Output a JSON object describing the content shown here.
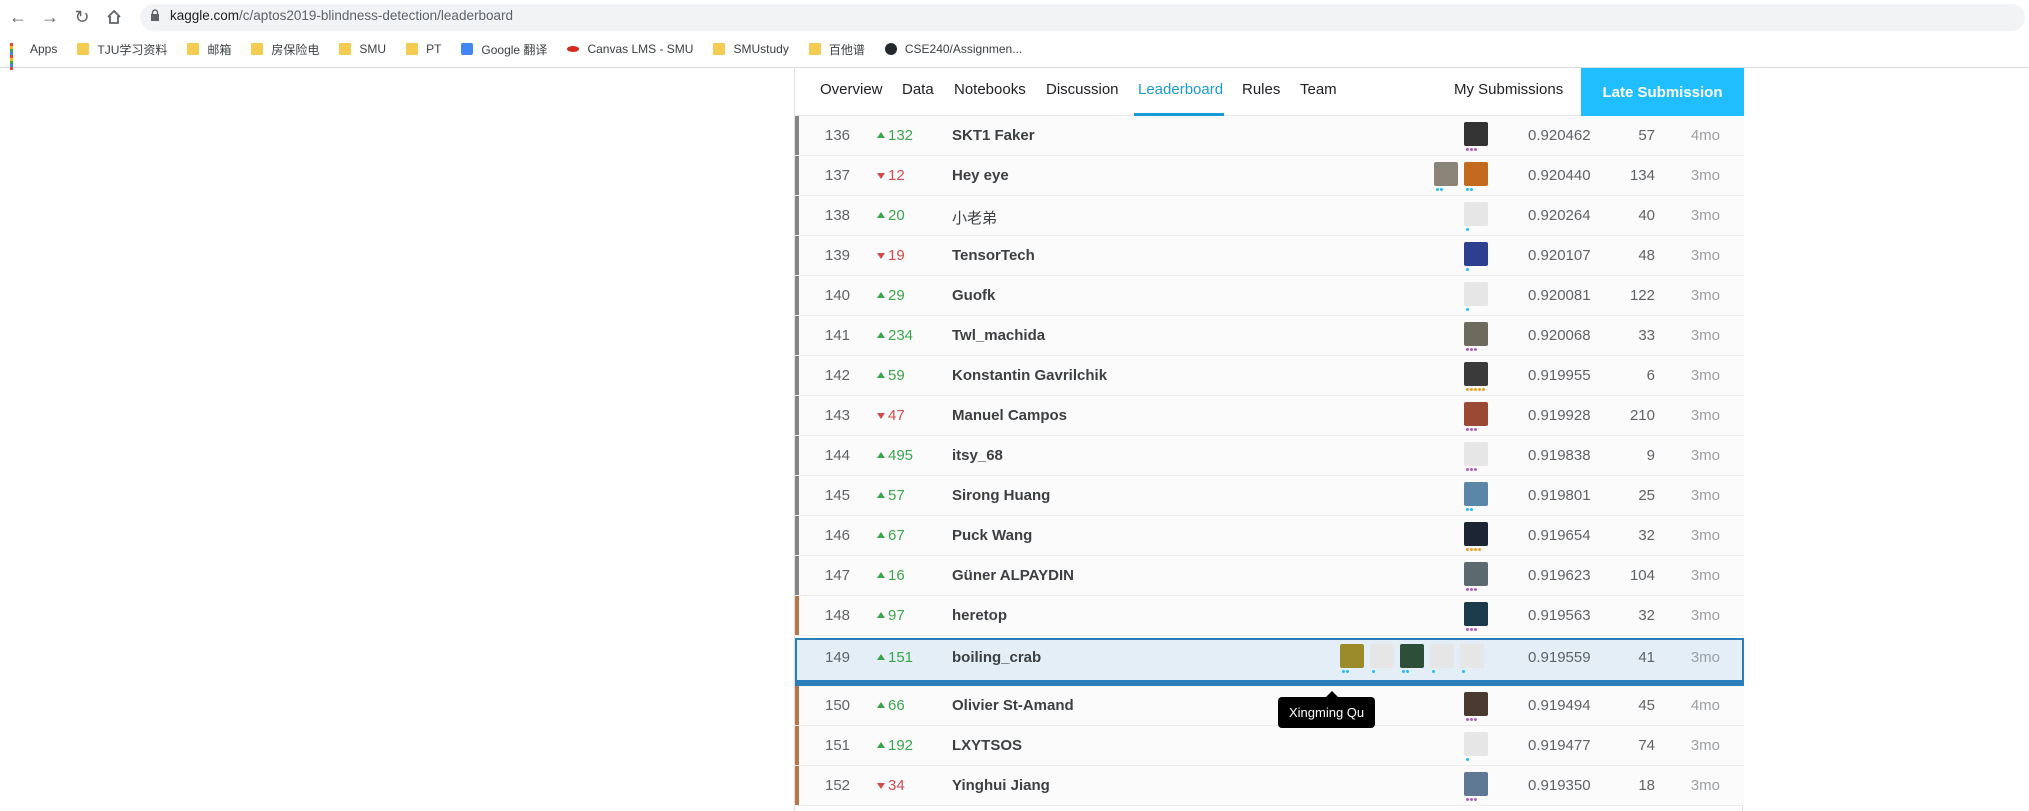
{
  "browser": {
    "url_host": "kaggle.com",
    "url_path": "/c/aptos2019-blindness-detection/leaderboard",
    "bookmarks": [
      {
        "label": "Apps",
        "icon": "apps-grid-icon"
      },
      {
        "label": "TJU学习资料",
        "icon": "folder-icon"
      },
      {
        "label": "邮箱",
        "icon": "folder-icon"
      },
      {
        "label": "房保险电",
        "icon": "folder-icon"
      },
      {
        "label": "SMU",
        "icon": "folder-icon"
      },
      {
        "label": "PT",
        "icon": "folder-icon"
      },
      {
        "label": "Google 翻译",
        "icon": "google-translate-icon"
      },
      {
        "label": "Canvas LMS - SMU",
        "icon": "canvas-icon"
      },
      {
        "label": "SMUstudy",
        "icon": "folder-icon"
      },
      {
        "label": "百他谱",
        "icon": "folder-icon"
      },
      {
        "label": "CSE240/Assignmen...",
        "icon": "github-icon"
      }
    ]
  },
  "tabs": [
    "Overview",
    "Data",
    "Notebooks",
    "Discussion",
    "Leaderboard",
    "Rules",
    "Team"
  ],
  "active_tab": "Leaderboard",
  "my_submissions": "My Submissions",
  "late_submission": "Late Submission",
  "colors": {
    "accent": "#20beff",
    "up": "#3aa54a",
    "down": "#d24b4b",
    "highlight_border": "#2a7fb8"
  },
  "rows": [
    {
      "rank": "136",
      "dir": "up",
      "delta": "132",
      "team": "SKT1 Faker",
      "score": "0.920462",
      "entries": "57",
      "last": "4mo",
      "medal": "none",
      "avatars": [
        {
          "c": "#333",
          "tier": [
            "#b05ec1",
            "#b05ec1",
            "#b05ec1"
          ]
        }
      ]
    },
    {
      "rank": "137",
      "dir": "down",
      "delta": "12",
      "team": "Hey eye",
      "score": "0.920440",
      "entries": "134",
      "last": "3mo",
      "medal": "none",
      "avatars": [
        {
          "c": "#c46a1e",
          "tier": [
            "#20beff",
            "#20beff"
          ]
        },
        {
          "c": "#8a8478",
          "tier": [
            "#20beff",
            "#20beff"
          ]
        }
      ]
    },
    {
      "rank": "138",
      "dir": "up",
      "delta": "20",
      "team": "小老弟",
      "score": "0.920264",
      "entries": "40",
      "last": "3mo",
      "medal": "none",
      "cjk": true,
      "avatars": [
        {
          "c": "#e6e6e6",
          "tier": [
            "#20beff"
          ]
        }
      ]
    },
    {
      "rank": "139",
      "dir": "down",
      "delta": "19",
      "team": "TensorTech",
      "score": "0.920107",
      "entries": "48",
      "last": "3mo",
      "medal": "none",
      "avatars": [
        {
          "c": "#2f3f8f",
          "tier": [
            "#20beff"
          ]
        }
      ]
    },
    {
      "rank": "140",
      "dir": "up",
      "delta": "29",
      "team": "Guofk",
      "score": "0.920081",
      "entries": "122",
      "last": "3mo",
      "medal": "none",
      "avatars": [
        {
          "c": "#e6e6e6",
          "tier": [
            "#20beff"
          ]
        }
      ]
    },
    {
      "rank": "141",
      "dir": "up",
      "delta": "234",
      "team": "Twl_machida",
      "score": "0.920068",
      "entries": "33",
      "last": "3mo",
      "medal": "none",
      "avatars": [
        {
          "c": "#6d6a5e",
          "tier": [
            "#b05ec1",
            "#b05ec1",
            "#b05ec1"
          ]
        }
      ]
    },
    {
      "rank": "142",
      "dir": "up",
      "delta": "59",
      "team": "Konstantin Gavrilchik",
      "score": "0.919955",
      "entries": "6",
      "last": "3mo",
      "medal": "none",
      "avatars": [
        {
          "c": "#3a3a3a",
          "tier": [
            "#f0a020",
            "#f0a020",
            "#f0a020",
            "#f0a020",
            "#f0a020"
          ]
        }
      ]
    },
    {
      "rank": "143",
      "dir": "down",
      "delta": "47",
      "team": "Manuel Campos",
      "score": "0.919928",
      "entries": "210",
      "last": "3mo",
      "medal": "none",
      "avatars": [
        {
          "c": "#9a4a34",
          "tier": [
            "#b05ec1",
            "#b05ec1",
            "#b05ec1"
          ]
        }
      ]
    },
    {
      "rank": "144",
      "dir": "up",
      "delta": "495",
      "team": "itsy_68",
      "score": "0.919838",
      "entries": "9",
      "last": "3mo",
      "medal": "none",
      "avatars": [
        {
          "c": "#e6e6e6",
          "tier": [
            "#b05ec1",
            "#b05ec1",
            "#b05ec1"
          ]
        }
      ]
    },
    {
      "rank": "145",
      "dir": "up",
      "delta": "57",
      "team": "Sirong Huang",
      "score": "0.919801",
      "entries": "25",
      "last": "3mo",
      "medal": "none",
      "avatars": [
        {
          "c": "#5a87a8",
          "tier": [
            "#20beff",
            "#20beff"
          ]
        }
      ]
    },
    {
      "rank": "146",
      "dir": "up",
      "delta": "67",
      "team": "Puck Wang",
      "score": "0.919654",
      "entries": "32",
      "last": "3mo",
      "medal": "none",
      "avatars": [
        {
          "c": "#1c2533",
          "tier": [
            "#f0a020",
            "#f0a020",
            "#f0a020",
            "#f0a020"
          ]
        }
      ]
    },
    {
      "rank": "147",
      "dir": "up",
      "delta": "16",
      "team": "Güner ALPAYDIN",
      "score": "0.919623",
      "entries": "104",
      "last": "3mo",
      "medal": "none",
      "avatars": [
        {
          "c": "#5c6a70",
          "tier": [
            "#b05ec1",
            "#b05ec1",
            "#b05ec1"
          ]
        }
      ]
    },
    {
      "rank": "148",
      "dir": "up",
      "delta": "97",
      "team": "heretop",
      "score": "0.919563",
      "entries": "32",
      "last": "3mo",
      "medal": "bronze",
      "avatars": [
        {
          "c": "#1b3a4a",
          "tier": [
            "#b05ec1",
            "#b05ec1",
            "#b05ec1"
          ]
        }
      ]
    },
    {
      "rank": "149",
      "dir": "up",
      "delta": "151",
      "team": "boiling_crab",
      "score": "0.919559",
      "entries": "41",
      "last": "3mo",
      "medal": "bronze",
      "highlight": true,
      "avatars": [
        {
          "c": "#e6e6e6",
          "tier": [
            "#20beff"
          ]
        },
        {
          "c": "#e6e6e6",
          "tier": [
            "#20beff"
          ]
        },
        {
          "c": "#2d4f3a",
          "tier": [
            "#20beff",
            "#20beff"
          ]
        },
        {
          "c": "#e6e6e6",
          "tier": [
            "#20beff"
          ]
        },
        {
          "c": "#9a8a2a",
          "tier": [
            "#20beff",
            "#20beff"
          ]
        }
      ]
    },
    {
      "rank": "150",
      "dir": "up",
      "delta": "66",
      "team": "Olivier St-Amand",
      "score": "0.919494",
      "entries": "45",
      "last": "4mo",
      "medal": "bronze",
      "avatars": [
        {
          "c": "#4a3a30",
          "tier": [
            "#b05ec1",
            "#b05ec1",
            "#b05ec1"
          ]
        }
      ]
    },
    {
      "rank": "151",
      "dir": "up",
      "delta": "192",
      "team": "LXYTSOS",
      "score": "0.919477",
      "entries": "74",
      "last": "3mo",
      "medal": "bronze",
      "avatars": [
        {
          "c": "#e6e6e6",
          "tier": [
            "#20beff"
          ]
        }
      ]
    },
    {
      "rank": "152",
      "dir": "down",
      "delta": "34",
      "team": "Yinghui Jiang",
      "score": "0.919350",
      "entries": "18",
      "last": "3mo",
      "medal": "bronze",
      "avatars": [
        {
          "c": "#5f7894",
          "tier": [
            "#b05ec1",
            "#b05ec1",
            "#b05ec1"
          ]
        }
      ]
    }
  ],
  "tooltip": "Xingming Qu"
}
